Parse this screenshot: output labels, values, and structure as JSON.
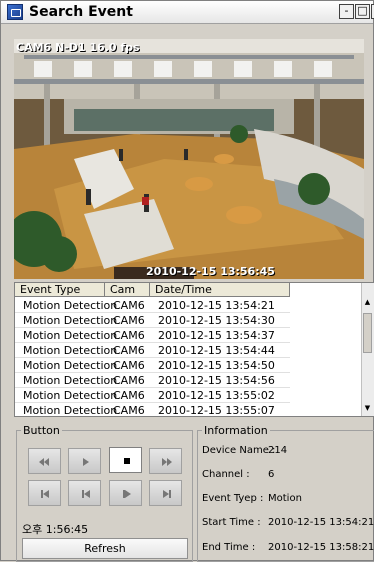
{
  "window": {
    "title": "Search Event",
    "minimize": "-",
    "maximize": "□",
    "close": "x"
  },
  "video": {
    "camera_label": "CAM6 N-D1 16.0 fps",
    "timestamp": "2010-12-15 13:56:45"
  },
  "list": {
    "columns": [
      "Event Type",
      "Cam",
      "Date/Time"
    ],
    "rows": [
      [
        "Motion Detection",
        "CAM6",
        "2010-12-15 13:54:21"
      ],
      [
        "Motion Detection",
        "CAM6",
        "2010-12-15 13:54:30"
      ],
      [
        "Motion Detection",
        "CAM6",
        "2010-12-15 13:54:37"
      ],
      [
        "Motion Detection",
        "CAM6",
        "2010-12-15 13:54:44"
      ],
      [
        "Motion Detection",
        "CAM6",
        "2010-12-15 13:54:50"
      ],
      [
        "Motion Detection",
        "CAM6",
        "2010-12-15 13:54:56"
      ],
      [
        "Motion Detection",
        "CAM6",
        "2010-12-15 13:55:02"
      ],
      [
        "Motion Detection",
        "CAM6",
        "2010-12-15 13:55:07"
      ]
    ]
  },
  "button_panel": {
    "legend": "Button",
    "buttons": [
      "rewind-icon",
      "play-icon",
      "stop-icon",
      "fast-forward-icon",
      "go-to-start-icon",
      "step-back-icon",
      "step-forward-icon",
      "go-to-end-icon"
    ],
    "clock": "오후 1:56:45",
    "refresh_label": "Refresh"
  },
  "information": {
    "legend": "Information",
    "device_name_label": "Device Name :",
    "device_name": "214",
    "channel_label": "Channel :",
    "channel": "6",
    "event_type_label": "Event Tyep :",
    "event_type": "Motion",
    "start_time_label": "Start Time :",
    "start_time": "2010-12-15 13:54:21",
    "end_time_label": "End Time :",
    "end_time": "2010-12-15 13:58:21"
  }
}
